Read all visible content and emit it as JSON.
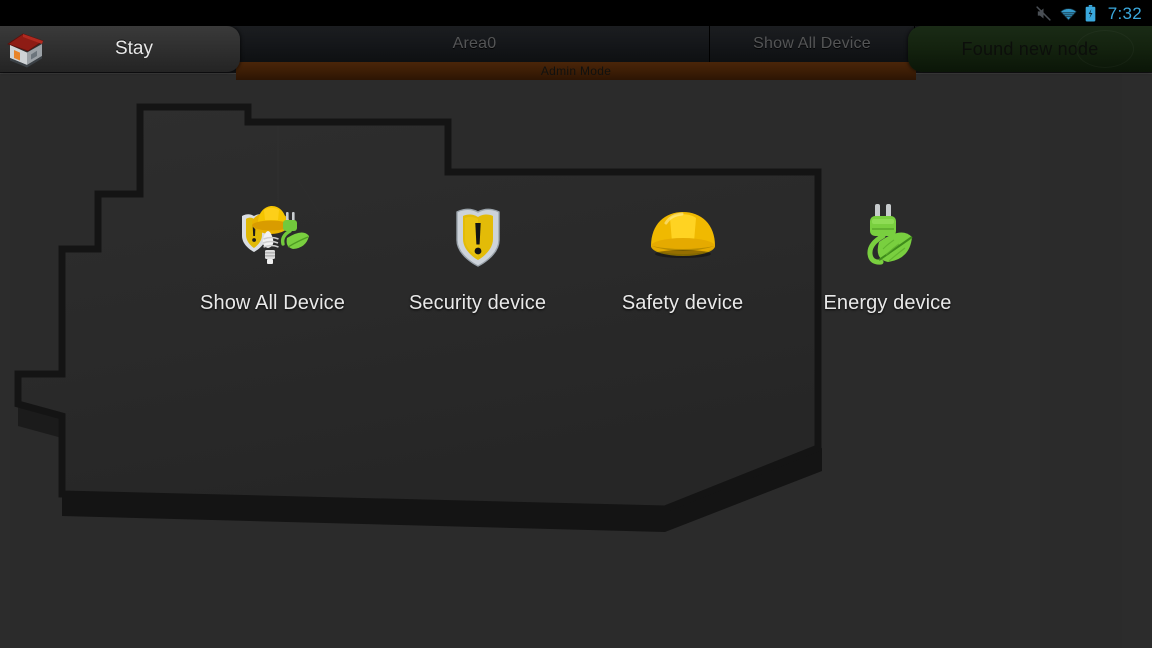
{
  "statusbar": {
    "time": "7:32",
    "icons": [
      {
        "name": "vibrate-muted-icon",
        "glyph": "sound-off"
      },
      {
        "name": "wifi-icon",
        "glyph": "wifi"
      },
      {
        "name": "battery-charging-icon",
        "glyph": "battery-bolt"
      }
    ],
    "accent_color": "#3aa8dd"
  },
  "header": {
    "home_icon": "home-icon",
    "active_tab_label": "Stay",
    "tabs": [
      {
        "label": "Area0",
        "selected": false
      },
      {
        "label": "Show All Device",
        "selected": false
      }
    ],
    "admin_mode_label": "Admin Mode",
    "admin_mode_color": "#3a1c05",
    "found_node_label": "Found new node",
    "found_node_color": "#14230f"
  },
  "floorplan": {
    "name": "room-outline",
    "wall_color": "#161616",
    "floor_color": "#292929",
    "background_color": "#2b2b2b"
  },
  "devices": [
    {
      "label": "Show All Device",
      "icon": "all-devices-icon",
      "name": "device-tile-show-all-device"
    },
    {
      "label": "Security device",
      "icon": "shield-warning-icon",
      "name": "device-tile-security-device"
    },
    {
      "label": "Safety device",
      "icon": "hard-hat-icon",
      "name": "device-tile-safety-device"
    },
    {
      "label": "Energy device",
      "icon": "plug-leaf-icon",
      "name": "device-tile-energy-device"
    }
  ]
}
